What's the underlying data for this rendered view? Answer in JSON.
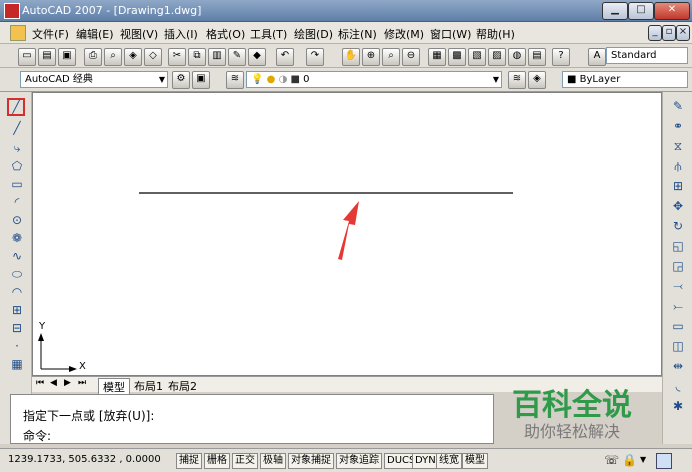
{
  "window": {
    "title": "AutoCAD 2007 - [Drawing1.dwg]"
  },
  "menu": [
    "文件(F)",
    "编辑(E)",
    "视图(V)",
    "插入(I)",
    "格式(O)",
    "工具(T)",
    "绘图(D)",
    "标注(N)",
    "修改(M)",
    "窗口(W)",
    "帮助(H)"
  ],
  "toolbar2": {
    "workspace": "AutoCAD 经典",
    "layer": "0",
    "text_style": "Standard",
    "color": "ByLayer"
  },
  "ucs": {
    "x_label": "X",
    "y_label": "Y"
  },
  "tabs": {
    "model": "模型",
    "layout1": "布局1",
    "layout2": "布局2"
  },
  "command": {
    "line1": "指定下一点或 [放弃(U)]:",
    "line2": "命令:"
  },
  "status": {
    "coords": "1239.1733, 505.6332 , 0.0000",
    "buttons": [
      "捕捉",
      "栅格",
      "正交",
      "极轴",
      "对象捕捉",
      "对象追踪",
      "DUCS",
      "DYN",
      "线宽",
      "模型"
    ]
  },
  "watermark": {
    "main": "百科全说",
    "sub": "助你轻松解决"
  },
  "colors": {
    "arrow": "#e53935",
    "highlight": "#d32f2f",
    "watermark": "#2e9a4a"
  }
}
